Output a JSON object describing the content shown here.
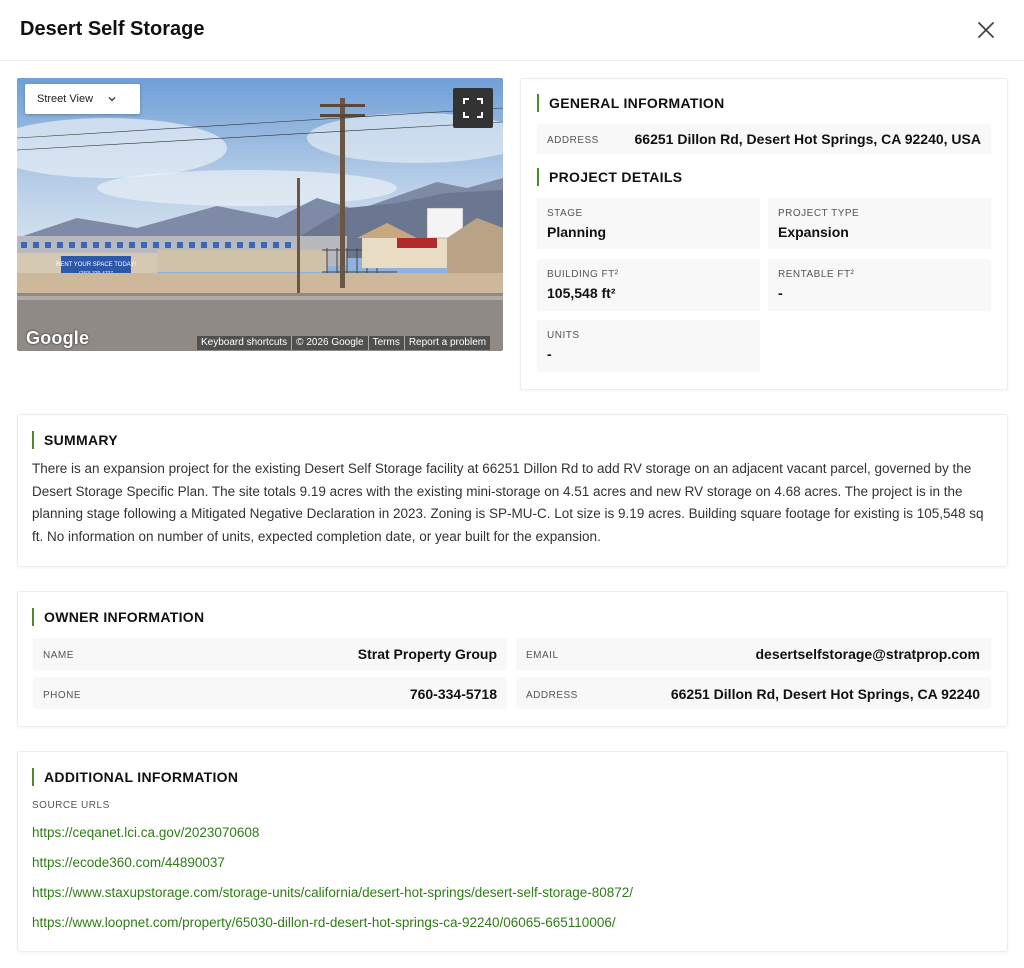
{
  "header": {
    "title": "Desert Self Storage",
    "close_icon": "close-icon"
  },
  "street_view": {
    "dropdown_label": "Street View",
    "fullscreen_icon": "fullscreen-icon",
    "logo_text": "Google",
    "attribution": [
      "Keyboard shortcuts",
      "© 2026 Google",
      "Terms",
      "Report a problem"
    ],
    "sign_text": "RENT YOUR SPACE TODAY!",
    "sign_phone": "(760) 329-4737"
  },
  "general": {
    "heading": "GENERAL INFORMATION",
    "address_label": "ADDRESS",
    "address_value": "66251 Dillon Rd, Desert Hot Springs, CA 92240, USA"
  },
  "project": {
    "heading": "PROJECT DETAILS",
    "stage_label": "STAGE",
    "stage_value": "Planning",
    "type_label": "PROJECT TYPE",
    "type_value": "Expansion",
    "building_label": "BUILDING FT²",
    "building_value": "105,548 ft²",
    "rentable_label": "RENTABLE FT²",
    "rentable_value": "-",
    "units_label": "UNITS",
    "units_value": "-"
  },
  "summary": {
    "heading": "SUMMARY",
    "text": "There is an expansion project for the existing Desert Self Storage facility at 66251 Dillon Rd to add RV storage on an adjacent vacant parcel, governed by the Desert Storage Specific Plan. The site totals 9.19 acres with the existing mini-storage on 4.51 acres and new RV storage on 4.68 acres. The project is in the planning stage following a Mitigated Negative Declaration in 2023. Zoning is SP-MU-C. Lot size is 9.19 acres. Building square footage for existing is 105,548 sq ft. No information on number of units, expected completion date, or year built for the expansion."
  },
  "owner": {
    "heading": "OWNER INFORMATION",
    "name_label": "NAME",
    "name_value": "Strat Property Group",
    "email_label": "EMAIL",
    "email_value": "desertselfstorage@stratprop.com",
    "phone_label": "PHONE",
    "phone_value": "760-334-5718",
    "address_label": "ADDRESS",
    "address_value": "66251 Dillon Rd, Desert Hot Springs, CA 92240"
  },
  "additional": {
    "heading": "ADDITIONAL INFORMATION",
    "source_label": "SOURCE URLS",
    "urls": [
      "https://ceqanet.lci.ca.gov/2023070608",
      "https://ecode360.com/44890037",
      "https://www.staxupstorage.com/storage-units/california/desert-hot-springs/desert-self-storage-80872/",
      "https://www.loopnet.com/property/65030-dillon-rd-desert-hot-springs-ca-92240/06065-665110006/"
    ]
  },
  "colors": {
    "accent": "#4b8b2a",
    "link": "#2f7d17",
    "panel_bg": "#f8f8f8"
  }
}
